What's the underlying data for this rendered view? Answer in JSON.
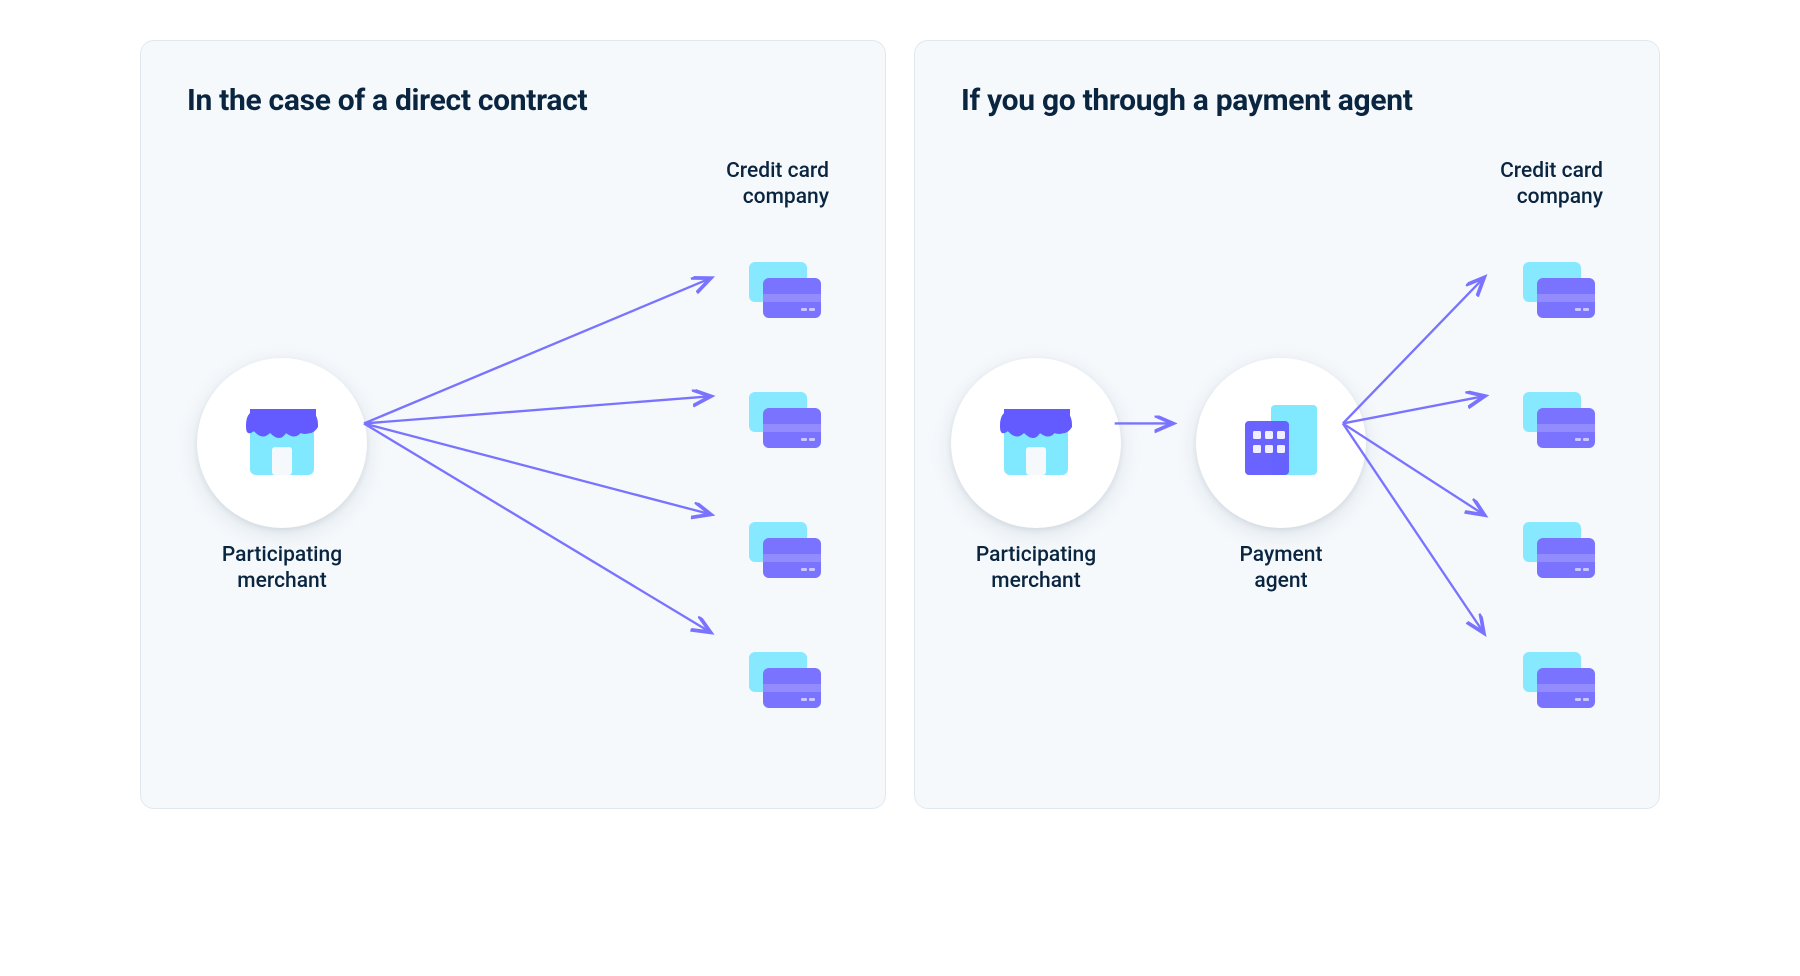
{
  "colors": {
    "background": "#f5f9fc",
    "border": "#e1e8ed",
    "text": "#0a2540",
    "teal": "#80e8ff",
    "purple": "#7a73ff",
    "arrow": "#7a73ff"
  },
  "left": {
    "title": "In the case of a direct contract",
    "merchant_label": "Participating\nmerchant",
    "cc_label": "Credit card\ncompany",
    "cc_count": 4
  },
  "right": {
    "title": "If you go through a payment agent",
    "merchant_label": "Participating\nmerchant",
    "agent_label": "Payment\nagent",
    "cc_label": "Credit card\ncompany",
    "cc_count": 4
  },
  "icons": {
    "merchant": "store-icon",
    "agent": "building-icon",
    "cc": "credit-card-icon"
  }
}
